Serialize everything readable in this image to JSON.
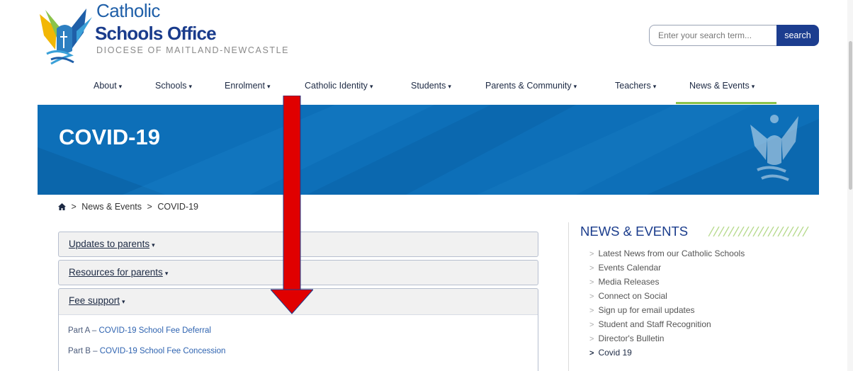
{
  "logo": {
    "line1": "Catholic",
    "line2": "Schools Office",
    "line3": "DIOCESE OF MAITLAND-NEWCASTLE"
  },
  "search": {
    "placeholder": "Enter your search term...",
    "button_label": "search"
  },
  "nav": {
    "items": [
      {
        "label": "About"
      },
      {
        "label": "Schools"
      },
      {
        "label": "Enrolment"
      },
      {
        "label": "Catholic Identity"
      },
      {
        "label": "Students"
      },
      {
        "label": "Parents & Community"
      },
      {
        "label": "Teachers"
      },
      {
        "label": "News & Events"
      }
    ],
    "caret": "▾",
    "active_color": "#8bc34a"
  },
  "banner": {
    "title": "COVID-19",
    "color": "#0d6fb8"
  },
  "breadcrumb": {
    "home_icon": "home-icon",
    "separator": ">",
    "items": [
      "News & Events",
      "COVID-19"
    ]
  },
  "accordion": {
    "sections": [
      {
        "label": "Updates to parents"
      },
      {
        "label": "Resources for parents"
      },
      {
        "label": "Fee support"
      }
    ],
    "fee_links": [
      {
        "prefix": "Part A – ",
        "text": "COVID-19 School Fee Deferral"
      },
      {
        "prefix": "Part B – ",
        "text": "COVID-19 School Fee Concession"
      }
    ]
  },
  "sidebar": {
    "title": "NEWS & EVENTS",
    "items": [
      {
        "label": "Latest News from our Catholic Schools"
      },
      {
        "label": "Events Calendar"
      },
      {
        "label": "Media Releases"
      },
      {
        "label": "Connect on Social"
      },
      {
        "label": "Sign up for email updates"
      },
      {
        "label": "Student and Staff Recognition"
      },
      {
        "label": "Director's Bulletin"
      },
      {
        "label": "Covid 19"
      }
    ]
  },
  "annotation": {
    "arrow_color": "#e00000",
    "arrow_icon": "down-arrow-icon"
  }
}
